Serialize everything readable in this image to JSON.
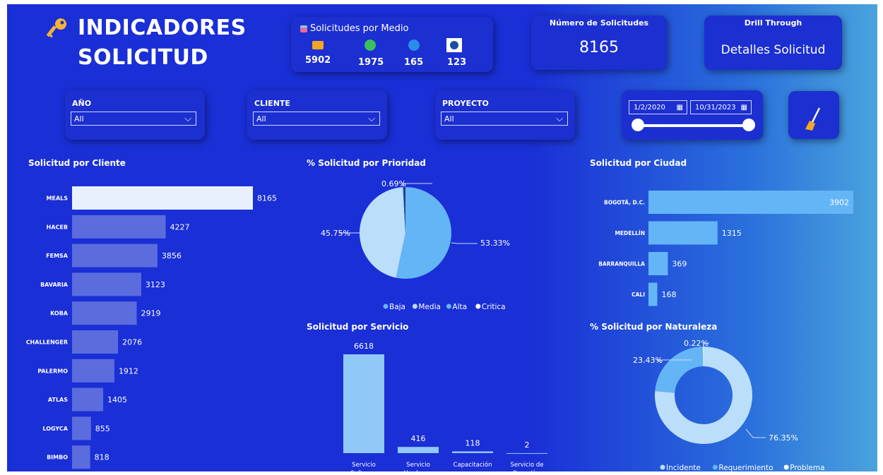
{
  "header": {
    "title_line1": "INDICADORES",
    "title_line2": "SOLICITUD"
  },
  "medio": {
    "title": "Solicitudes por Medio",
    "items": [
      {
        "icon": "email-icon",
        "count": "5902"
      },
      {
        "icon": "whatsapp-icon",
        "count": "1975"
      },
      {
        "icon": "phone-icon",
        "count": "165"
      },
      {
        "icon": "portal-icon",
        "count": "123"
      }
    ]
  },
  "numero": {
    "title": "Número de Solicitudes",
    "value": "8165"
  },
  "drill": {
    "title": "Drill Through",
    "button": "Detalles Solicitud"
  },
  "filters": {
    "anio": {
      "label": "AÑO",
      "value": "All"
    },
    "cliente": {
      "label": "CLIENTE",
      "value": "All"
    },
    "proyecto": {
      "label": "PROYECTO",
      "value": "All"
    }
  },
  "date_range": {
    "start": "1/2/2020",
    "end": "10/31/2023"
  },
  "colors": {
    "background": "#1a2fd6",
    "bar_cliente": "#5b6ddd",
    "bar_top": "#e8f0fd",
    "light_blue": "#64b5f6",
    "pale_blue": "#bbdefb"
  },
  "chart_data": [
    {
      "id": "cliente",
      "type": "bar",
      "orientation": "horizontal",
      "title": "Solicitud por Cliente",
      "categories": [
        "MEALS",
        "HACEB",
        "FEMSA",
        "BAVARIA",
        "KOBA",
        "CHALLENGER",
        "PALERMO",
        "ATLAS",
        "LOGYCA",
        "BIMBO"
      ],
      "values": [
        8165,
        4227,
        3856,
        3123,
        2919,
        2076,
        1912,
        1405,
        855,
        818
      ],
      "value_labels": [
        "8165",
        "4227",
        "3856",
        "3123",
        "2919",
        "2076",
        "1912",
        "1405",
        "855",
        "818"
      ]
    },
    {
      "id": "prioridad",
      "type": "pie",
      "title": "% Solicitud por Prioridad",
      "labels": [
        "Baja",
        "Media",
        "Alta",
        "Critica"
      ],
      "values": [
        53.33,
        45.75,
        0.23,
        0.69
      ],
      "value_labels": {
        "Baja": "53.33%",
        "Media": "45.75%",
        "Critica": "0.69%"
      },
      "colors": [
        "#64b5f6",
        "#bbdefb",
        "#1e88e5",
        "#2c3e80"
      ]
    },
    {
      "id": "ciudad",
      "type": "bar",
      "orientation": "horizontal",
      "title": "Solicitud por Ciudad",
      "categories": [
        "BOGOTÁ, D.C.",
        "MEDELLÍN",
        "BARRANQUILLA",
        "CALI"
      ],
      "values": [
        3902,
        1315,
        369,
        168
      ],
      "value_labels": [
        "3902",
        "1315",
        "369",
        "168"
      ]
    },
    {
      "id": "servicio",
      "type": "bar",
      "orientation": "vertical",
      "title": "Solicitud por Servicio",
      "categories": [
        [
          "Servicio",
          "Software"
        ],
        [
          "Servicio",
          "Hardware"
        ],
        [
          "Capacitación"
        ],
        [
          "Servicio de",
          "Garantías"
        ]
      ],
      "values": [
        6618,
        416,
        118,
        2
      ],
      "value_labels": [
        "6618",
        "416",
        "118",
        "2"
      ]
    },
    {
      "id": "naturaleza",
      "type": "pie",
      "donut": true,
      "title": "% Solicitud por Naturaleza",
      "labels": [
        "Incidente",
        "Requerimiento",
        "Problema"
      ],
      "values": [
        76.35,
        23.43,
        0.22
      ],
      "value_labels": {
        "Incidente": "76.35%",
        "Requerimiento": "23.43%",
        "Problema": "0.22%"
      },
      "colors": [
        "#bbdefb",
        "#64b5f6",
        "#ffffff"
      ]
    }
  ]
}
